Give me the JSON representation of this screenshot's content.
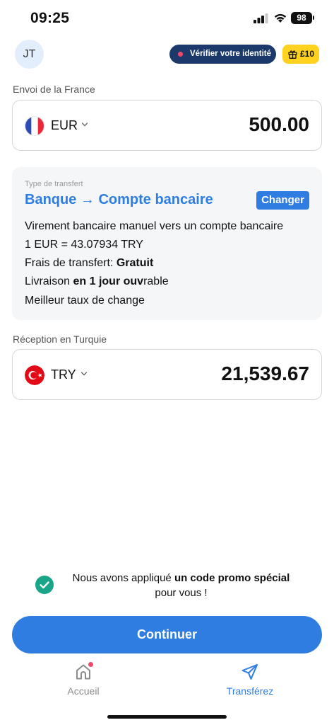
{
  "status_bar": {
    "time": "09:25",
    "battery": "98"
  },
  "header": {
    "avatar_initials": "JT",
    "verify_label": "Vérifier votre identité",
    "reward_label": "£10"
  },
  "send": {
    "label": "Envoi de la France",
    "currency": "EUR",
    "amount": "500.00",
    "flag": "france-flag"
  },
  "transfer": {
    "type_label": "Type de transfert",
    "type": "Banque → Compte bancaire",
    "change_label": "Changer",
    "description": "Virement bancaire manuel vers un compte bancaire",
    "rate": "1 EUR = 43.07934 TRY",
    "fee_prefix": "Frais de transfert: ",
    "fee_value": "Gratuit",
    "delivery_prefix": "Livraison ",
    "delivery_bold": "en 1 jour ouv",
    "delivery_suffix": "rable",
    "best_rate": "Meilleur taux de change"
  },
  "receive": {
    "label": "Réception en Turquie",
    "currency": "TRY",
    "amount": "21,539.67",
    "flag": "turkey-flag"
  },
  "promo": {
    "prefix": "Nous avons appliqué ",
    "bold": "un code promo spécial",
    "suffix": "pour vous !"
  },
  "continue_label": "Continuer",
  "nav": {
    "home_label": "Accueil",
    "transfer_label": "Transférez"
  },
  "colors": {
    "accent": "#2f7de1",
    "verify_bg": "#1b3a6b",
    "reward_bg": "#ffd21f",
    "notification_dot": "#f04a6a",
    "promo_check": "#1aa589"
  }
}
